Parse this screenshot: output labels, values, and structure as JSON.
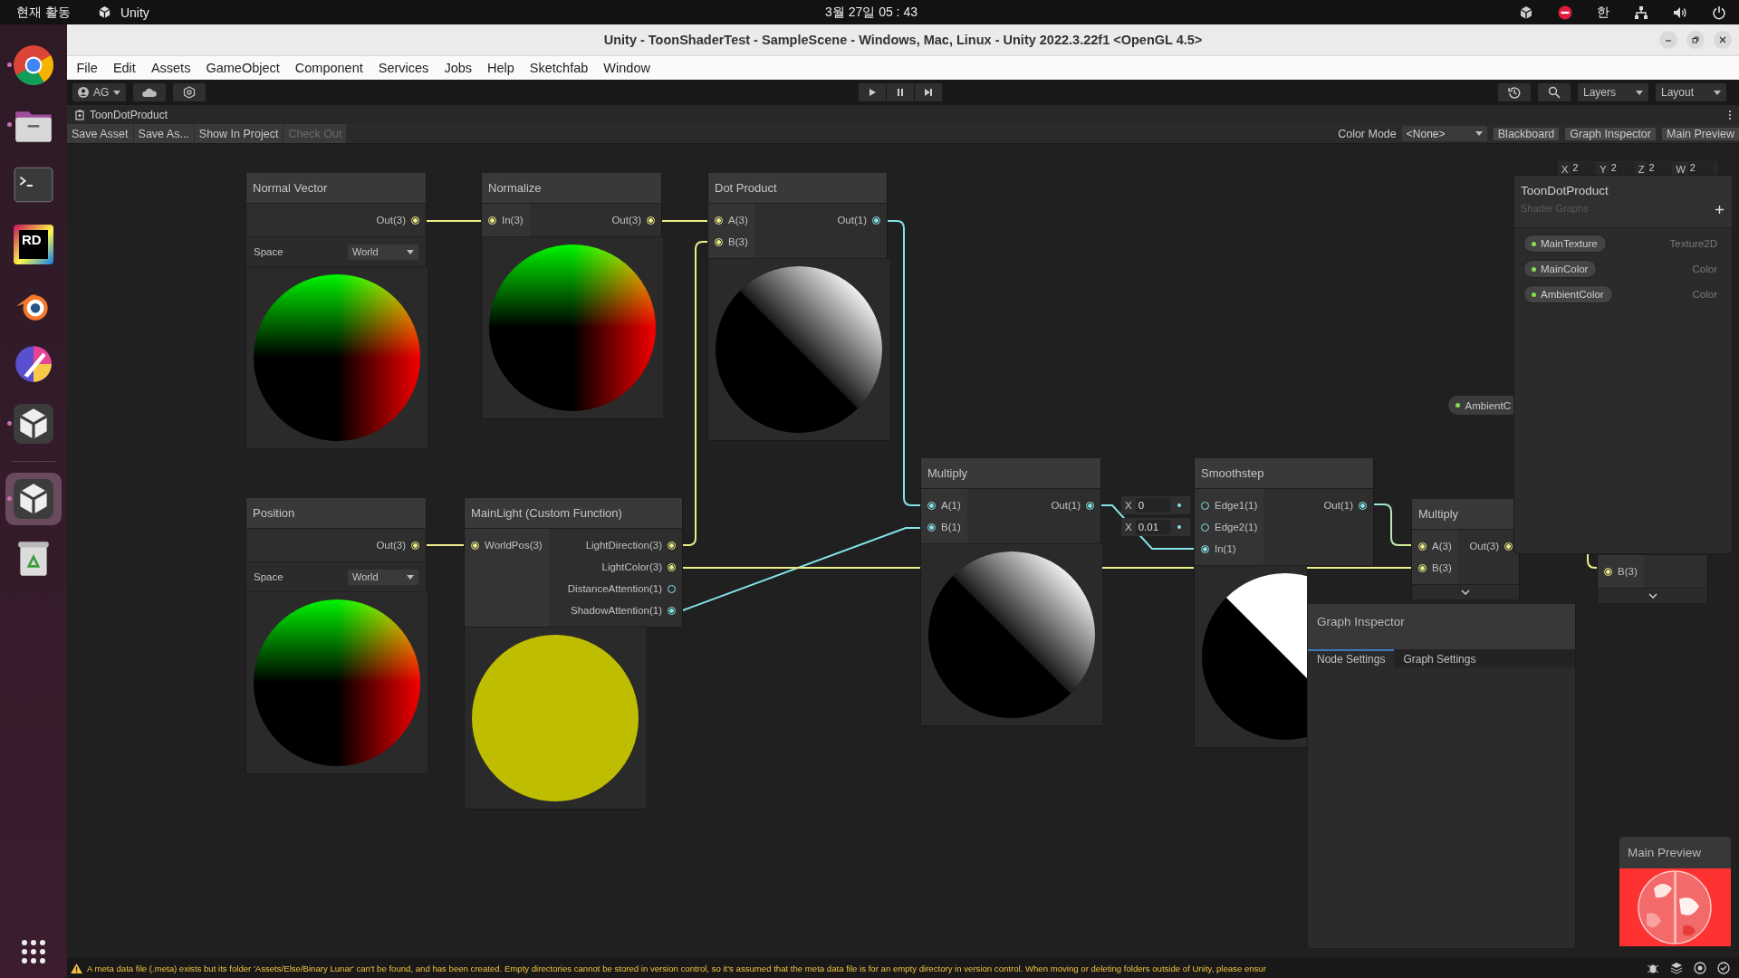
{
  "top_bar": {
    "activities": "현재 활동",
    "app_name": "Unity",
    "clock": "3월 27일  05 : 43",
    "input_method": "한"
  },
  "dock": [
    {
      "kind": "chrome",
      "running": true,
      "selected": false
    },
    {
      "kind": "files",
      "running": true,
      "selected": false
    },
    {
      "kind": "terminal",
      "running": false,
      "selected": false
    },
    {
      "kind": "rider",
      "label": "RD",
      "running": false,
      "selected": false
    },
    {
      "kind": "blender",
      "running": false,
      "selected": false
    },
    {
      "kind": "krita",
      "running": false,
      "selected": false
    },
    {
      "kind": "unity",
      "running": true,
      "selected": false
    },
    {
      "kind": "unity",
      "running": true,
      "selected": true
    },
    {
      "kind": "trash",
      "running": false,
      "selected": false
    }
  ],
  "window": {
    "title": "Unity - ToonShaderTest - SampleScene - Windows, Mac, Linux - Unity 2022.3.22f1 <OpenGL 4.5>",
    "menu": [
      "File",
      "Edit",
      "Assets",
      "GameObject",
      "Component",
      "Services",
      "Jobs",
      "Help",
      "Sketchfab",
      "Window"
    ]
  },
  "toolbar": {
    "account": "AG",
    "layers": "Layers",
    "layout": "Layout"
  },
  "document_tab": "ToonDotProduct",
  "graph_toolbar": {
    "buttons": [
      {
        "label": "Save Asset",
        "disabled": false
      },
      {
        "label": "Save As...",
        "disabled": false
      },
      {
        "label": "Show In Project",
        "disabled": false
      },
      {
        "label": "Check Out",
        "disabled": true
      }
    ],
    "color_mode_label": "Color Mode",
    "color_mode": "<None>",
    "toggles": [
      {
        "label": "Blackboard",
        "selected": true
      },
      {
        "label": "Graph Inspector",
        "selected": true
      },
      {
        "label": "Main Preview",
        "selected": true
      }
    ]
  },
  "nodes": [
    {
      "title": "Normal Vector",
      "outputs": [
        {
          "label": "Out(3)",
          "kind": "vector3",
          "connected": true
        }
      ],
      "setting": {
        "label": "Space",
        "value": "World"
      },
      "kind": "normal"
    },
    {
      "title": "Normalize",
      "inputs": [
        {
          "label": "In(3)",
          "kind": "vector3",
          "connected": true
        }
      ],
      "outputs": [
        {
          "label": "Out(3)",
          "kind": "vector3",
          "connected": true
        }
      ],
      "kind": "normal"
    },
    {
      "title": "Dot Product",
      "inputs": [
        {
          "label": "A(3)",
          "kind": "vector3",
          "connected": true
        },
        {
          "label": "B(3)",
          "kind": "vector3",
          "connected": true
        }
      ],
      "outputs": [
        {
          "label": "Out(1)",
          "kind": "float",
          "connected": true
        }
      ],
      "kind": "shade"
    },
    {
      "title": "Position",
      "outputs": [
        {
          "label": "Out(3)",
          "kind": "vector3",
          "connected": true
        }
      ],
      "setting": {
        "label": "Space",
        "value": "World"
      },
      "kind": "normal"
    },
    {
      "title": "MainLight (Custom Function)",
      "inputs": [
        {
          "label": "WorldPos(3)",
          "kind": "vector3",
          "connected": true
        }
      ],
      "outputs": [
        {
          "label": "LightDirection(3)",
          "kind": "vector3",
          "connected": true
        },
        {
          "label": "LightColor(3)",
          "kind": "vector3",
          "connected": true
        },
        {
          "label": "DistanceAttention(1)",
          "kind": "float",
          "connected": false
        },
        {
          "label": "ShadowAttention(1)",
          "kind": "float",
          "connected": true
        }
      ],
      "kind": "yellow"
    },
    {
      "title": "Multiply",
      "inputs": [
        {
          "label": "A(1)",
          "kind": "float",
          "connected": true
        },
        {
          "label": "B(1)",
          "kind": "float",
          "connected": true
        }
      ],
      "outputs": [
        {
          "label": "Out(1)",
          "kind": "float",
          "connected": true
        }
      ],
      "kind": "shade"
    },
    {
      "title": "Smoothstep",
      "inputs": [
        {
          "label": "Edge1(1)",
          "kind": "float",
          "connected": false,
          "literal": {
            "axis": "X",
            "value": "0"
          }
        },
        {
          "label": "Edge2(1)",
          "kind": "float",
          "connected": false,
          "literal": {
            "axis": "X",
            "value": "0.01"
          }
        },
        {
          "label": "In(1)",
          "kind": "float",
          "connected": true
        }
      ],
      "outputs": [
        {
          "label": "Out(1)",
          "kind": "float",
          "connected": true
        }
      ],
      "kind": "step"
    },
    {
      "title": "Multiply",
      "inputs": [
        {
          "label": "A(3)",
          "kind": "vector3",
          "connected": true
        },
        {
          "label": "B(3)",
          "kind": "vector3",
          "connected": true
        }
      ],
      "outputs": [
        {
          "label": "Out(3)",
          "kind": "vector3",
          "connected": true
        }
      ],
      "expanded": false
    },
    {
      "inputs": [
        {
          "label": "B(3)",
          "kind": "vector3",
          "connected": true
        }
      ],
      "expanded": false
    }
  ],
  "vector_fields": [
    {
      "axis": "X",
      "value": "2"
    },
    {
      "axis": "Y",
      "value": "2"
    },
    {
      "axis": "Z",
      "value": "2"
    },
    {
      "axis": "W",
      "value": "2"
    }
  ],
  "floating_property": {
    "label": "AmbientC"
  },
  "blackboard": {
    "title": "ToonDotProduct",
    "subtitle": "Shader Graphs",
    "properties": [
      {
        "name": "MainTexture",
        "type": "Texture2D"
      },
      {
        "name": "MainColor",
        "type": "Color"
      },
      {
        "name": "AmbientColor",
        "type": "Color"
      }
    ]
  },
  "graph_inspector": {
    "title": "Graph Inspector",
    "tabs": [
      {
        "label": "Node Settings",
        "selected": true
      },
      {
        "label": "Graph Settings",
        "selected": false
      }
    ]
  },
  "main_preview": {
    "title": "Main Preview",
    "kind": "picture"
  },
  "status_bar": {
    "message": "A meta data file (.meta) exists but its folder 'Assets/Else/Binary Lunar' can't be found, and has been created. Empty directories cannot be stored in version control, so it's assumed that the meta data file is for an empty directory in version control. When moving or deleting folders outside of Unity, please ensur"
  }
}
